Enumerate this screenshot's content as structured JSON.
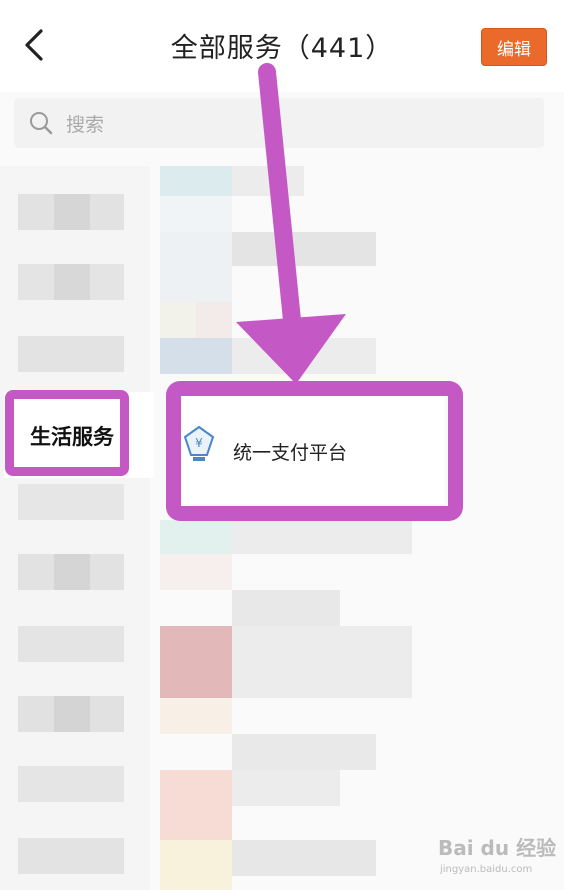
{
  "header": {
    "back_icon": "back-arrow-icon",
    "title": "全部服务（441）",
    "edit_label": "编辑"
  },
  "search": {
    "placeholder": "搜索",
    "icon": "search-icon"
  },
  "sidebar": {
    "selected_label": "生活服务"
  },
  "services": {
    "selected_label": "统一支付平台",
    "selected_icon": "payment-platform-icon"
  },
  "watermark": {
    "text": "Bai du 经验",
    "sub": "jingyan.baidu.com"
  },
  "colors": {
    "accent": "#ea6a2c",
    "highlight": "#c459c5"
  }
}
